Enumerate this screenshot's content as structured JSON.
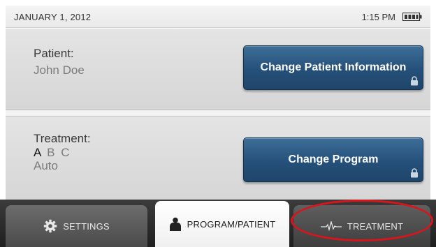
{
  "status_bar": {
    "date": "JANUARY 1, 2012",
    "time": "1:15 PM",
    "battery_icon": "battery-icon"
  },
  "patient": {
    "label": "Patient:",
    "name": "John Doe",
    "button_label": "Change Patient Information",
    "button_icon": "lock-icon"
  },
  "treatment": {
    "label": "Treatment:",
    "programs": [
      "A",
      "B",
      "C"
    ],
    "active_program": "A",
    "mode": "Auto",
    "button_label": "Change Program",
    "button_icon": "lock-icon"
  },
  "tabs": [
    {
      "label": "SETTINGS",
      "icon": "gear-icon",
      "active": false
    },
    {
      "label": "PROGRAM/PATIENT",
      "icon": "person-icon",
      "active": true
    },
    {
      "label": "TREATMENT",
      "icon": "waveform-icon",
      "active": false
    }
  ],
  "colors": {
    "button_blue": "#25507a",
    "panel_gray": "#dddddd",
    "tab_bar": "#2a2a2a",
    "highlight_red": "#d9141b"
  }
}
